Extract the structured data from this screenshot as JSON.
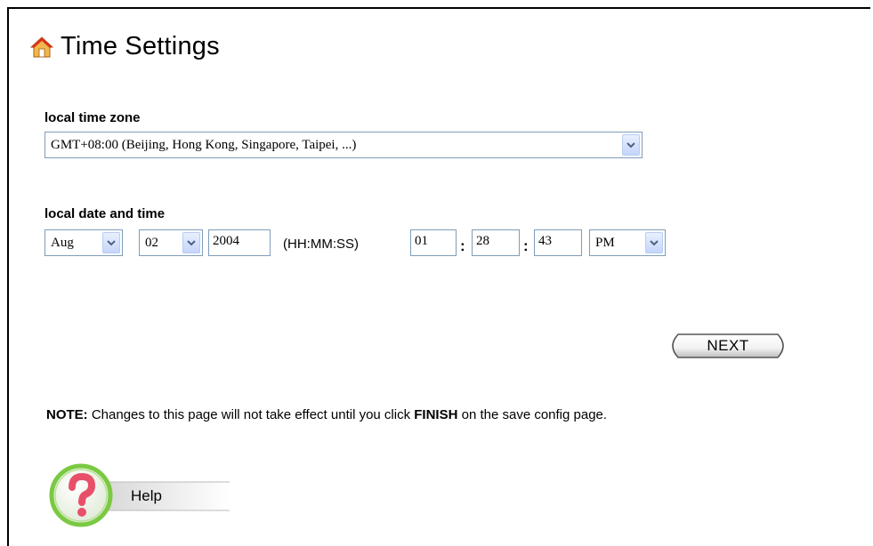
{
  "page": {
    "title": "Time Settings"
  },
  "timezone": {
    "label": "local time zone",
    "selected": "GMT+08:00 (Beijing, Hong Kong, Singapore, Taipei, ...)"
  },
  "datetime": {
    "label": "local date and time",
    "month": "Aug",
    "day": "02",
    "year": "2004",
    "format_hint": "(HH:MM:SS)",
    "hour": "01",
    "minute": "28",
    "second": "43",
    "ampm": "PM",
    "separator": ":"
  },
  "actions": {
    "next_label": "NEXT"
  },
  "note": {
    "prefix": "NOTE:",
    "text_before": " Changes to this page will not take effect until you click ",
    "emphasis": "FINISH",
    "text_after": " on the save config page."
  },
  "help": {
    "label": "Help"
  },
  "colors": {
    "input_border": "#7f9db9",
    "dropdown_button": "#c5d5fb",
    "help_ring": "#7ac943",
    "help_mark": "#e8506a"
  }
}
